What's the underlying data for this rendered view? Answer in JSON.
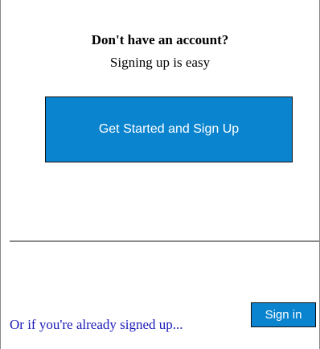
{
  "signup": {
    "heading": "Don't have an account?",
    "subheading": "Signing up is easy",
    "cta_label": "Get Started and Sign Up"
  },
  "signin": {
    "prompt_text": "Or if you're already signed up...",
    "button_label": "Sign in"
  },
  "colors": {
    "button_background": "#0a84cf",
    "link_text": "#1a1ab8",
    "divider": "#8a8a8a"
  }
}
